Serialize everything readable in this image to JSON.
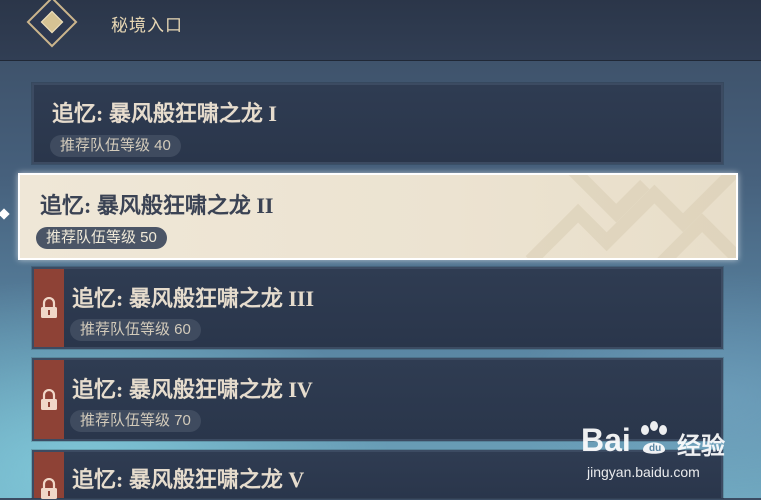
{
  "header": {
    "title": "秘境入口",
    "emblem_icon": "diamond-emblem-icon"
  },
  "domains": [
    {
      "title": "追忆: 暴风般狂啸之龙 I",
      "level": "推荐队伍等级 40",
      "locked": false,
      "selected": false
    },
    {
      "title": "追忆: 暴风般狂啸之龙 II",
      "level": "推荐队伍等级 50",
      "locked": false,
      "selected": true
    },
    {
      "title": "追忆: 暴风般狂啸之龙 III",
      "level": "推荐队伍等级 60",
      "locked": true,
      "selected": false
    },
    {
      "title": "追忆: 暴风般狂啸之龙 IV",
      "level": "推荐队伍等级 70",
      "locked": true,
      "selected": false
    },
    {
      "title": "追忆: 暴风般狂啸之龙 V",
      "level": "",
      "locked": true,
      "selected": false
    }
  ],
  "watermark": {
    "logo": "Bai",
    "logo_suffix": "经验",
    "url": "jingyan.baidu.com"
  },
  "colors": {
    "header_bg": "#2b3649",
    "card_bg": "#2f3c52",
    "selected_bg": "#efe7d7",
    "lock_red": "#8e4236",
    "gold": "#d6c394"
  }
}
